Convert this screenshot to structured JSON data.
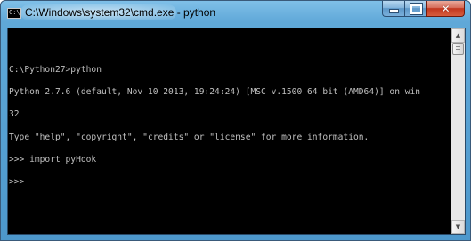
{
  "window": {
    "title": "C:\\Windows\\system32\\cmd.exe - python",
    "app_icon_text": "C:\\",
    "buttons": {
      "minimize_icon": "minimize-icon",
      "maximize_icon": "maximize-icon",
      "close_label": "✕"
    }
  },
  "console": {
    "lines": [
      "",
      "C:\\Python27>python",
      "Python 2.7.6 (default, Nov 10 2013, 19:24:24) [MSC v.1500 64 bit (AMD64)] on win",
      "32",
      "Type \"help\", \"copyright\", \"credits\" or \"license\" for more information.",
      ">>> import pyHook",
      ">>> "
    ]
  },
  "scrollbar": {
    "up_arrow": "▲",
    "down_arrow": "▼",
    "position_fraction": 0.0
  },
  "colors": {
    "console_background": "#000000",
    "console_text": "#c0c0c0",
    "title_bar": "#5fa8d8",
    "close_button": "#c2371e"
  }
}
